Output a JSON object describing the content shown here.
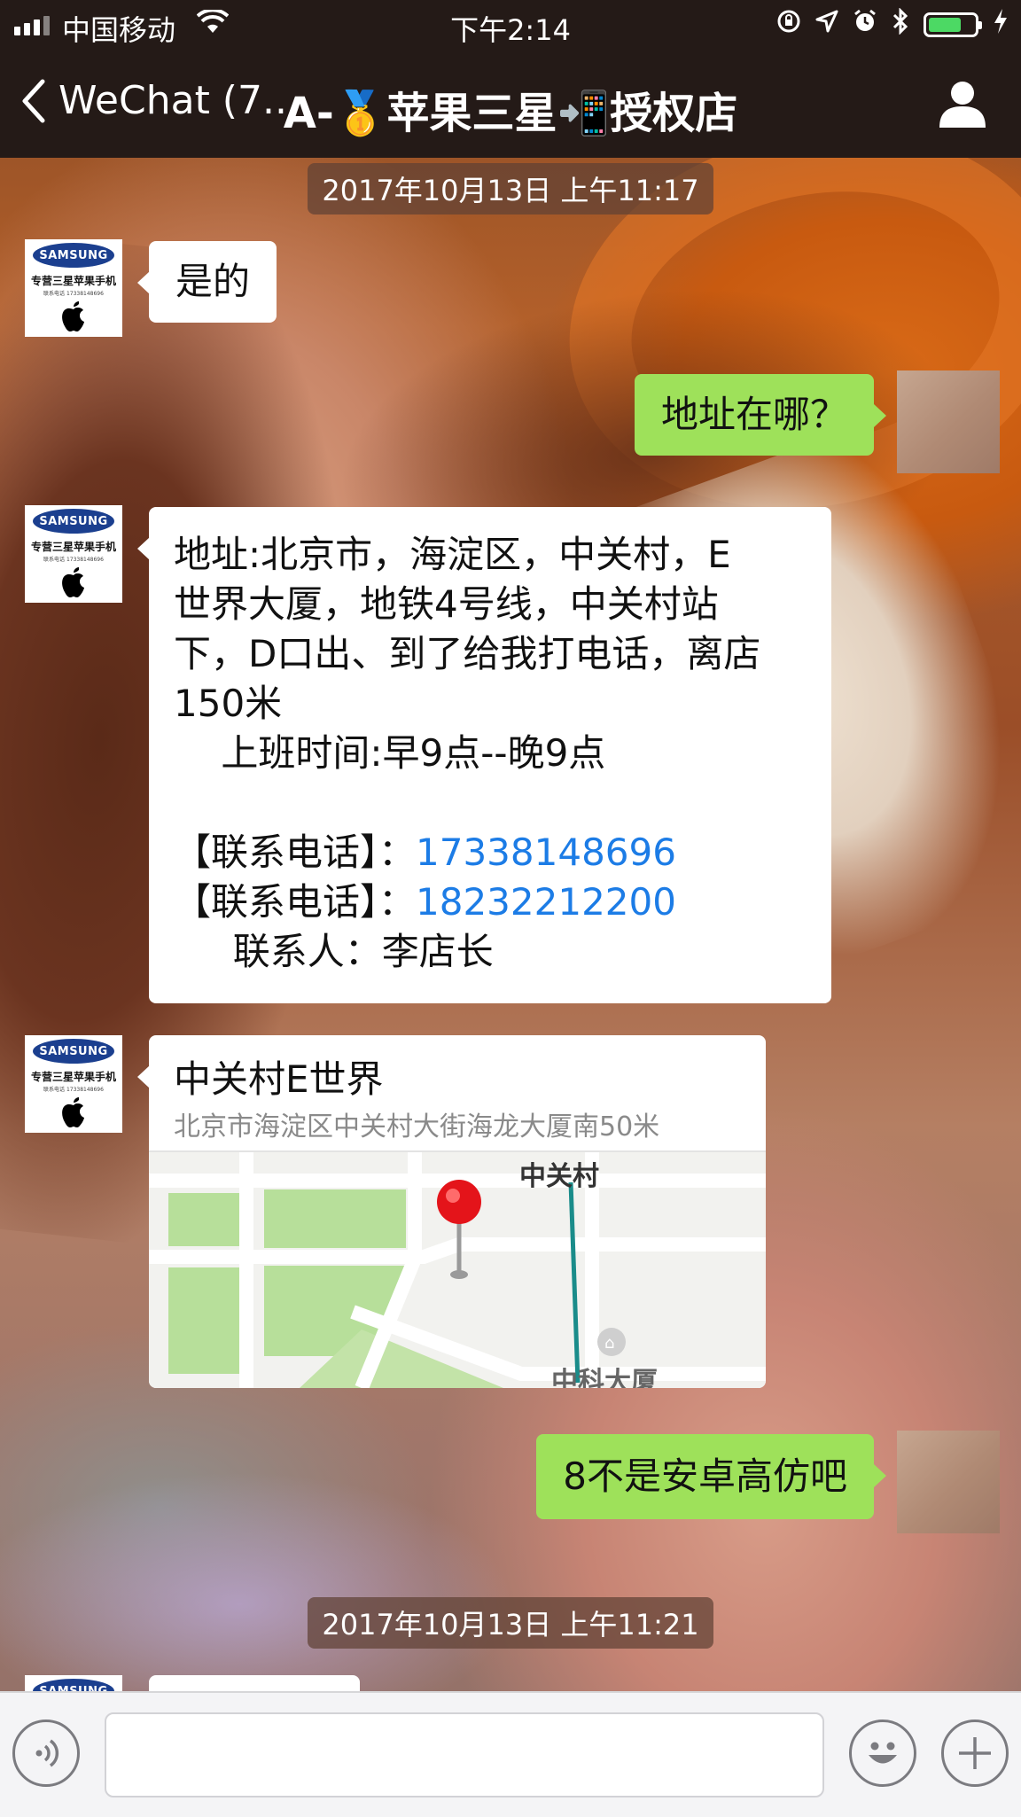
{
  "status_bar": {
    "carrier": "中国移动",
    "time": "下午2:14",
    "icons": [
      "signal-bars-icon",
      "wifi-icon",
      "orientation-lock-icon",
      "location-arrow-icon",
      "alarm-icon",
      "bluetooth-icon",
      "battery-icon",
      "charging-bolt-icon"
    ],
    "battery_level": 0.6,
    "battery_color": "#4cd964"
  },
  "nav": {
    "back_label": "WeChat (7...",
    "title": "A-🥇苹果三星📲授权店",
    "profile_icon": "person-icon"
  },
  "contact_avatar": {
    "brand": "SAMSUNG",
    "caption": "专营三星苹果手机",
    "small_text": "联系电话 17338148696"
  },
  "messages": [
    {
      "type": "timestamp",
      "text": "2017年10月13日 上午11:17"
    },
    {
      "type": "text",
      "side": "in",
      "text": "是的"
    },
    {
      "type": "text",
      "side": "out",
      "text": "地址在哪？"
    },
    {
      "type": "text",
      "side": "in",
      "lines": [
        "地址:北京市，海淀区，中关村，E",
        "世界大厦，地铁4号线，中关村站",
        "下，D口出、到了给我打电话，离店",
        "150米",
        "    上班时间:早9点--晚9点",
        ""
      ],
      "phone_label": "【联系电话】：",
      "phones": [
        "17338148696",
        "18232212200"
      ],
      "contact_line": "     联系人：李店长"
    },
    {
      "type": "location",
      "side": "in",
      "title": "中关村E世界",
      "address": "北京市海淀区中关村大街海龙大厦南50米",
      "map_labels": [
        "中关村",
        "中科大厦"
      ]
    },
    {
      "type": "text",
      "side": "out",
      "text": "8不是安卓高仿吧"
    },
    {
      "type": "timestamp",
      "text": "2017年10月13日 上午11:21"
    }
  ],
  "input_bar": {
    "value": "",
    "voice_icon": "voice-icon",
    "emoji_icon": "emoji-icon",
    "more_icon": "plus-icon"
  },
  "colors": {
    "nav_bg": "#241a17",
    "out_bubble": "#9ee15a",
    "in_bubble": "#ffffff",
    "phone_link": "#1c7ce6"
  }
}
